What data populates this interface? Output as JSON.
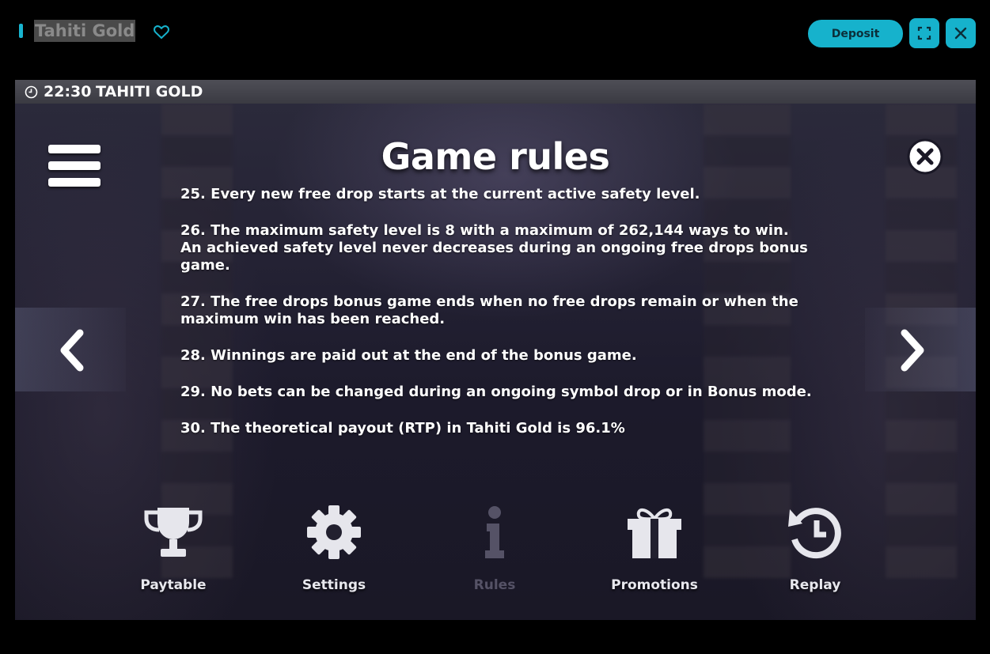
{
  "header": {
    "game_title": "Tahiti Gold",
    "deposit_label": "Deposit"
  },
  "game": {
    "time": "22:30",
    "title": "TAHITI GOLD",
    "heading": "Game rules",
    "rules": [
      "25. Every new free drop starts at the current active safety level.",
      "26. The maximum safety level is 8 with a maximum of 262,144 ways to win. An achieved safety level never decreases during an ongoing free drops bonus game.",
      "27. The free drops bonus game ends when no free drops remain or when the maximum win has been reached.",
      "28. Winnings are paid out at the end of the bonus game.",
      "29. No bets can be changed during an ongoing symbol drop or in Bonus mode.",
      "30. The theoretical payout (RTP) in Tahiti Gold is 96.1%"
    ],
    "nav": [
      {
        "label": "Paytable",
        "icon": "trophy-icon"
      },
      {
        "label": "Settings",
        "icon": "gear-icon"
      },
      {
        "label": "Rules",
        "icon": "info-icon",
        "active": true
      },
      {
        "label": "Promotions",
        "icon": "gift-icon"
      },
      {
        "label": "Replay",
        "icon": "replay-icon"
      }
    ]
  },
  "colors": {
    "accent": "#16b2cc",
    "background": "#000000",
    "nav_dim": "#555266"
  }
}
